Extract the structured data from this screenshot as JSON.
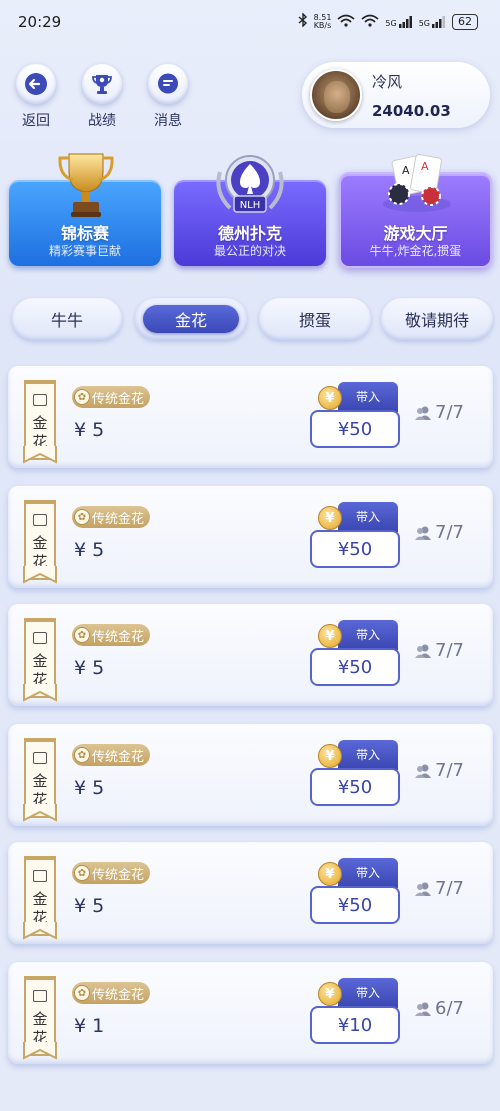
{
  "status_bar": {
    "time": "20:29",
    "net_speed_top": "8.51",
    "net_speed_bottom": "KB/s",
    "signal1": "5G",
    "signal2": "5G",
    "battery": "62"
  },
  "nav": {
    "back": "返回",
    "records": "战绩",
    "messages": "消息"
  },
  "profile": {
    "name": "冷风",
    "balance": "24040.03"
  },
  "categories": [
    {
      "title": "锦标赛",
      "subtitle": "精彩赛事巨献"
    },
    {
      "title": "德州扑克",
      "subtitle": "最公正的对决",
      "logo_text": "NLH"
    },
    {
      "title": "游戏大厅",
      "subtitle": "牛牛,炸金花,掼蛋"
    }
  ],
  "tabs": [
    {
      "label": "牛牛"
    },
    {
      "label": "金花"
    },
    {
      "label": "掼蛋"
    },
    {
      "label": "敬请期待"
    }
  ],
  "rooms": [
    {
      "ribbon": "金花",
      "badge": "传统金花",
      "price": "¥ 5",
      "buyin_label": "带入",
      "buyin": "¥50",
      "players": "7/7"
    },
    {
      "ribbon": "金花",
      "badge": "传统金花",
      "price": "¥ 5",
      "buyin_label": "带入",
      "buyin": "¥50",
      "players": "7/7"
    },
    {
      "ribbon": "金花",
      "badge": "传统金花",
      "price": "¥ 5",
      "buyin_label": "带入",
      "buyin": "¥50",
      "players": "7/7"
    },
    {
      "ribbon": "金花",
      "badge": "传统金花",
      "price": "¥ 5",
      "buyin_label": "带入",
      "buyin": "¥50",
      "players": "7/7"
    },
    {
      "ribbon": "金花",
      "badge": "传统金花",
      "price": "¥ 5",
      "buyin_label": "带入",
      "buyin": "¥50",
      "players": "7/7"
    },
    {
      "ribbon": "金花",
      "badge": "传统金花",
      "price": "¥ 1",
      "buyin_label": "带入",
      "buyin": "¥10",
      "players": "6/7"
    }
  ],
  "colors": {
    "accent": "#4b58c8",
    "gold": "#c8a766"
  }
}
